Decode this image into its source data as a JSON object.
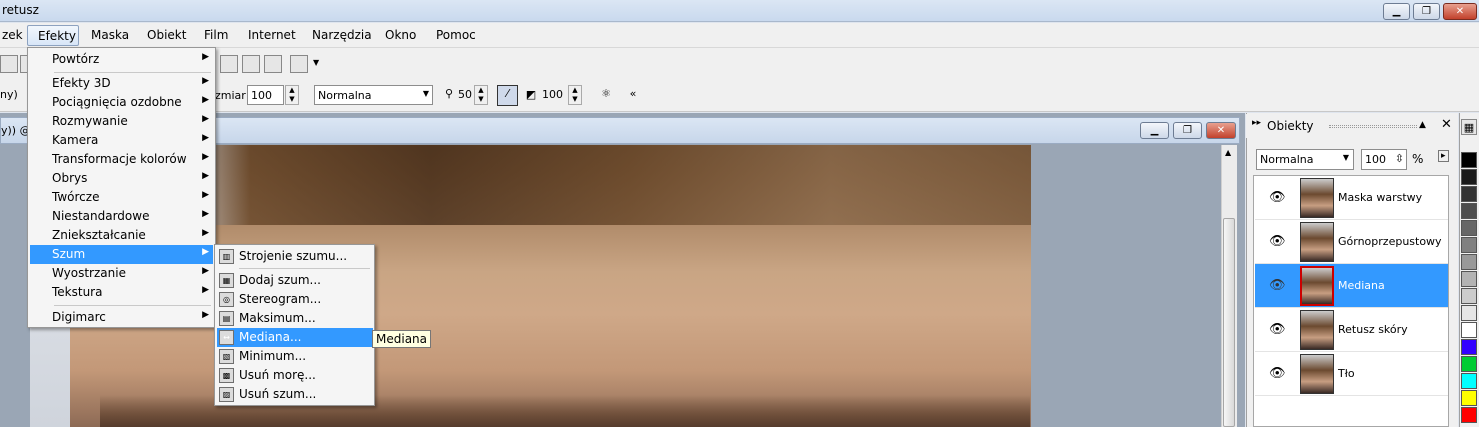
{
  "window": {
    "title": "retusz",
    "minimize": "▁",
    "maximize": "❐",
    "close": "✕"
  },
  "menubar": {
    "items": [
      {
        "label": "zek"
      },
      {
        "label": "Efekty"
      },
      {
        "label": "Maska"
      },
      {
        "label": "Obiekt"
      },
      {
        "label": "Film"
      },
      {
        "label": "Internet"
      },
      {
        "label": "Narzędzia"
      },
      {
        "label": "Okno"
      },
      {
        "label": "Pomoc"
      }
    ]
  },
  "toolbar2": {
    "left_value": "ny)",
    "size_label": "zmiar",
    "size_value": "100",
    "blend_mode": "Normalna",
    "transparency_value": "50",
    "opacity_value": "100"
  },
  "document": {
    "title": "y)) @"
  },
  "effects_menu": {
    "items": [
      {
        "label": "Powtórz",
        "submenu": true
      },
      {
        "label": "Efekty 3D",
        "submenu": true
      },
      {
        "label": "Pociągnięcia ozdobne",
        "submenu": true
      },
      {
        "label": "Rozmywanie",
        "submenu": true
      },
      {
        "label": "Kamera",
        "submenu": true
      },
      {
        "label": "Transformacje kolorów",
        "submenu": true
      },
      {
        "label": "Obrys",
        "submenu": true
      },
      {
        "label": "Twórcze",
        "submenu": true
      },
      {
        "label": "Niestandardowe",
        "submenu": true
      },
      {
        "label": "Zniekształcanie",
        "submenu": true
      },
      {
        "label": "Szum",
        "submenu": true,
        "highlighted": true
      },
      {
        "label": "Wyostrzanie",
        "submenu": true
      },
      {
        "label": "Tekstura",
        "submenu": true
      },
      {
        "label": "Digimarc",
        "submenu": true
      }
    ]
  },
  "noise_submenu": {
    "items": [
      {
        "label": "Strojenie szumu...",
        "icon": "tune-noise-icon"
      },
      {
        "label": "Dodaj szum...",
        "icon": "add-noise-icon"
      },
      {
        "label": "Stereogram...",
        "icon": "stereogram-icon"
      },
      {
        "label": "Maksimum...",
        "icon": "maximum-icon"
      },
      {
        "label": "Mediana...",
        "icon": "median-icon",
        "highlighted": true
      },
      {
        "label": "Minimum...",
        "icon": "minimum-icon"
      },
      {
        "label": "Usuń morę...",
        "icon": "remove-moire-icon"
      },
      {
        "label": "Usuń szum...",
        "icon": "remove-noise-icon"
      }
    ]
  },
  "tooltip": {
    "text": "Mediana"
  },
  "objects_panel": {
    "title": "Obiekty",
    "blend_mode": "Normalna",
    "opacity": "100",
    "percent": "%",
    "layers": [
      {
        "name": "Maska warstwy",
        "selected": false
      },
      {
        "name": "Górnoprzepustowy",
        "selected": false
      },
      {
        "name": "Mediana",
        "selected": true
      },
      {
        "name": "Retusz skóry",
        "selected": false
      },
      {
        "name": "Tło",
        "selected": false
      }
    ]
  },
  "palette": {
    "colors": [
      "#000000",
      "#1a1a1a",
      "#333333",
      "#4d4d4d",
      "#666666",
      "#808080",
      "#999999",
      "#b3b3b3",
      "#cccccc",
      "#e6e6e6",
      "#ffffff",
      "#3300ff",
      "#00cc33",
      "#00ffff",
      "#ffff00",
      "#ff0000"
    ]
  }
}
